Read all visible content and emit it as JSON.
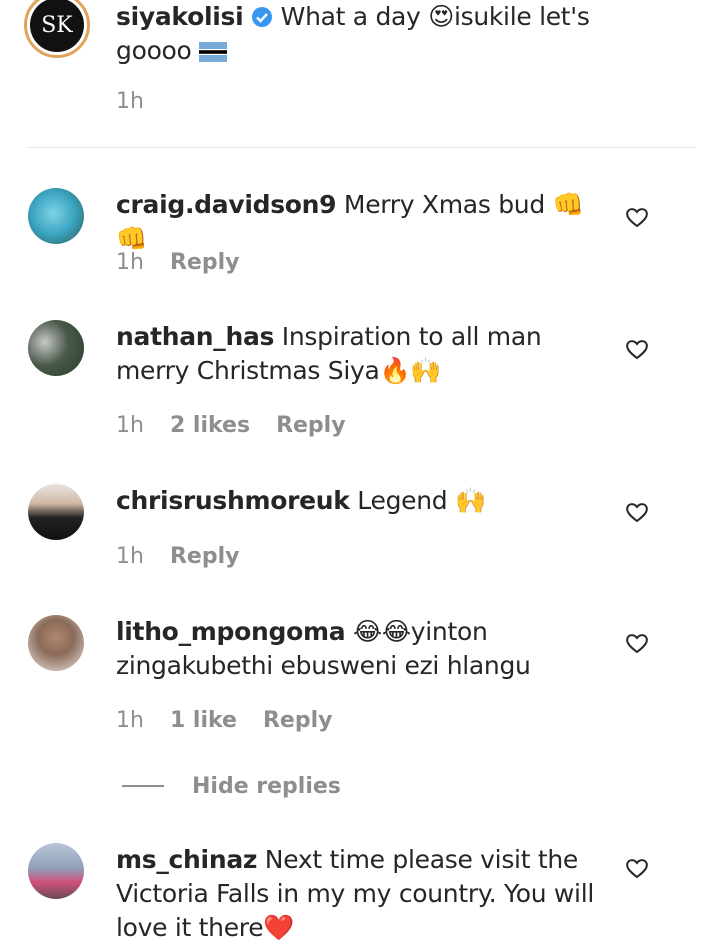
{
  "owner_comment": {
    "username": "siyakolisi",
    "avatar_initials": "SK",
    "text_before": "What a day ",
    "text_after": "isukile let's goooo",
    "time": "1h"
  },
  "replies": [
    {
      "username": "craig.davidson9",
      "text": "Merry Xmas bud ",
      "emoji": "👊👊",
      "time": "1h",
      "likes": "",
      "reply_label": "Reply"
    },
    {
      "username": "nathan_has",
      "text": "Inspiration to all man merry Christmas Siya",
      "emoji": "🔥🙌",
      "time": "1h",
      "likes": "2 likes",
      "reply_label": "Reply"
    },
    {
      "username": "chrisrushmoreuk",
      "text": "Legend ",
      "emoji": "🙌",
      "time": "1h",
      "likes": "",
      "reply_label": "Reply"
    },
    {
      "username": "litho_mpongoma",
      "text_prefix_emoji": "😂😂",
      "text": "yinton zingakubethi ebusweni ezi hlangu",
      "time": "1h",
      "likes": "1 like",
      "reply_label": "Reply"
    },
    {
      "username": "ms_chinaz",
      "text": "Next time please visit the Victoria Falls in my my country. You will love it there",
      "emoji": "❤️",
      "time": "",
      "likes": "",
      "reply_label": ""
    }
  ],
  "hide_replies_label": "Hide replies",
  "colors": {
    "text": "#262626",
    "meta": "#8e8e8e",
    "verified": "#3897f0",
    "divider": "#e6e6e6"
  }
}
